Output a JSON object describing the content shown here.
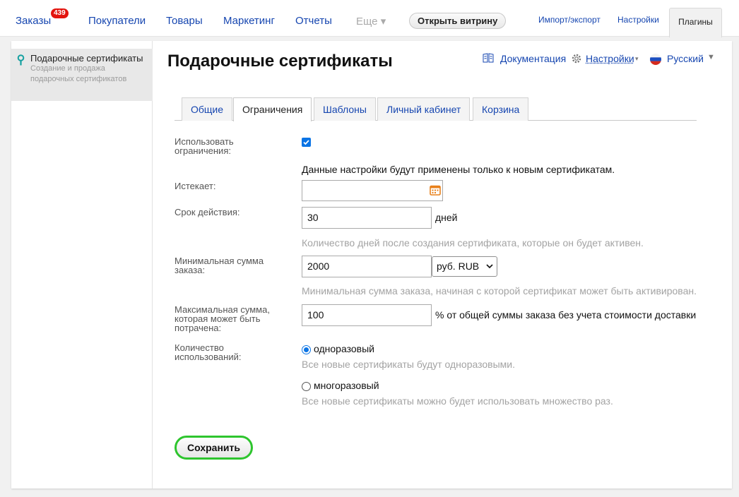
{
  "nav": {
    "orders": "Заказы",
    "orders_badge": "439",
    "customers": "Покупатели",
    "products": "Товары",
    "marketing": "Маркетинг",
    "reports": "Отчеты",
    "more": "Еще ▾",
    "storefront": "Открыть витрину",
    "import_export": "Импорт/экспорт",
    "settings": "Настройки",
    "plugins": "Плагины"
  },
  "sidebar": {
    "items": [
      {
        "title": "Подарочные сертификаты",
        "description": "Создание и продажа подарочных сертификатов"
      }
    ]
  },
  "page": {
    "title": "Подарочные сертификаты",
    "docs": "Документация",
    "settings": "Настройки",
    "language": "Русский"
  },
  "tabs": [
    "Общие",
    "Ограничения",
    "Шаблоны",
    "Личный кабинет",
    "Корзина"
  ],
  "active_tab": "Ограничения",
  "form": {
    "use_restrictions_label": "Использовать ограничения:",
    "use_restrictions_checked": true,
    "note": "Данные настройки будут применены только к новым сертификатам.",
    "expires_label": "Истекает:",
    "expires_value": "",
    "validity_label": "Срок действия:",
    "validity_value": "30",
    "validity_unit": "дней",
    "validity_hint": "Количество дней после создания сертификата, которые он будет активен.",
    "min_sum_label": "Минимальная сумма заказа:",
    "min_sum_value": "2000",
    "currency_selected": "руб. RUB",
    "min_sum_hint": "Минимальная сумма заказа, начиная с которой сертификат может быть активирован.",
    "max_sum_label": "Максимальная сумма, которая может быть потрачена:",
    "max_sum_value": "100",
    "max_sum_suffix": "% от общей суммы заказа без учета стоимости доставки",
    "usage_label": "Количество использований:",
    "usage_options": [
      {
        "label": "одноразовый",
        "hint": "Все новые сертификаты будут одноразовыми.",
        "selected": true
      },
      {
        "label": "многоразовый",
        "hint": "Все новые сертификаты можно будет использовать множество раз.",
        "selected": false
      }
    ],
    "save_label": "Сохранить"
  },
  "colors": {
    "link": "#1646b0",
    "accent": "#0b74e5",
    "save_outline": "#2ec52e",
    "badge": "#e3140e"
  }
}
